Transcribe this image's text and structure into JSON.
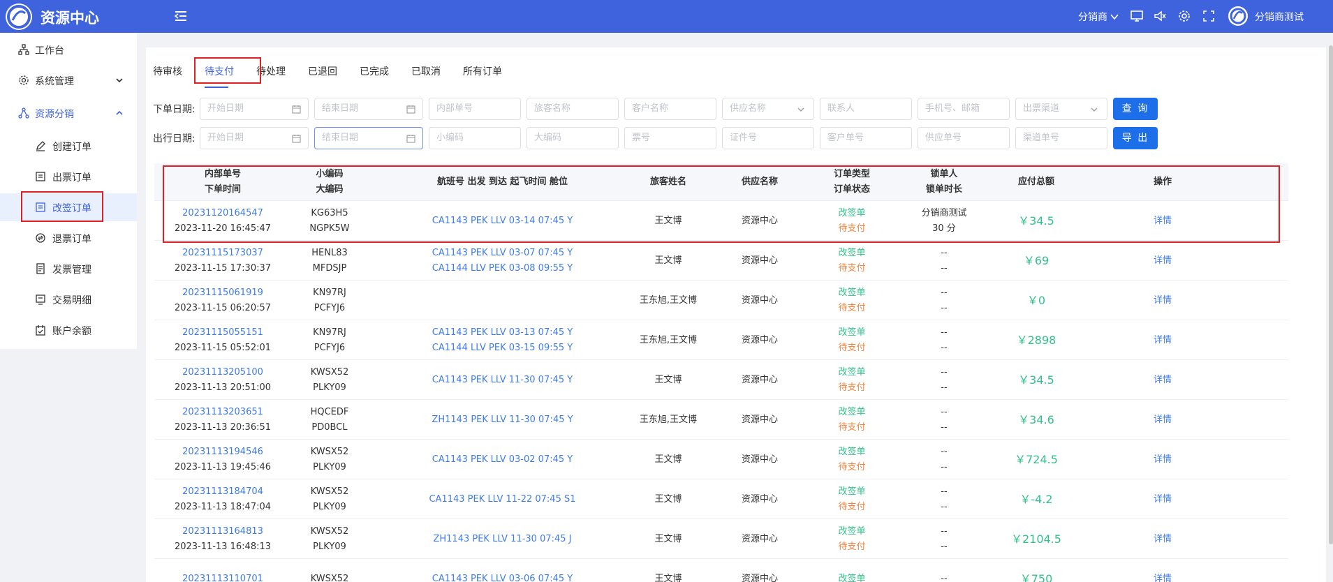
{
  "header": {
    "app_title": "资源中心",
    "role_label": "分销商",
    "user_name": "分销商测试"
  },
  "sidebar": {
    "items": [
      {
        "label": "工作台",
        "icon": "workbench-icon"
      },
      {
        "label": "系统管理",
        "icon": "gear-icon"
      },
      {
        "label": "资源分销",
        "icon": "distribution-icon"
      }
    ],
    "sub_items": [
      {
        "label": "创建订单",
        "icon": "edit-icon"
      },
      {
        "label": "出票订单",
        "icon": "ticket-icon"
      },
      {
        "label": "改签订单",
        "icon": "reschedule-icon"
      },
      {
        "label": "退票订单",
        "icon": "refund-icon"
      },
      {
        "label": "发票管理",
        "icon": "invoice-icon"
      },
      {
        "label": "交易明细",
        "icon": "transaction-icon"
      },
      {
        "label": "账户余额",
        "icon": "balance-icon"
      }
    ]
  },
  "tabs": [
    "待审核",
    "待支付",
    "待处理",
    "已退回",
    "已完成",
    "已取消",
    "所有订单"
  ],
  "filters": {
    "order_date_label": "下单日期:",
    "travel_date_label": "出行日期:",
    "start_date": "开始日期",
    "end_date": "结束日期",
    "row1": [
      "内部单号",
      "旅客名称",
      "客户名称",
      "供应名称",
      "联系人",
      "手机号、邮箱",
      "出票渠道"
    ],
    "row2": [
      "小编码",
      "大编码",
      "票号",
      "证件号",
      "客户单号",
      "供应单号",
      "渠道单号"
    ],
    "query_button": "查 询",
    "export_button": "导 出"
  },
  "table": {
    "headers": {
      "order_no": "内部单号",
      "order_time": "下单时间",
      "small_code": "小编码",
      "big_code": "大编码",
      "flight": "航班号 出发 到达 起飞时间 舱位",
      "passenger": "旅客姓名",
      "supplier": "供应名称",
      "order_type": "订单类型",
      "order_status": "订单状态",
      "locker": "锁单人",
      "lock_duration": "锁单时长",
      "amount": "应付总额",
      "action": "操作"
    },
    "rows": [
      {
        "order_no": "20231120164547",
        "time": "2023-11-20 16:45:47",
        "small": "KG63H5",
        "big": "NGPK5W",
        "flights": [
          "CA1143 PEK LLV 03-14 07:45 Y"
        ],
        "passenger": "王文博",
        "supplier": "资源中心",
        "type": "改签单",
        "status": "待支付",
        "locker": "分销商测试",
        "lock": "30 分",
        "amount": "￥34.5",
        "action": "详情"
      },
      {
        "order_no": "20231115173037",
        "time": "2023-11-15 17:30:37",
        "small": "HENL83",
        "big": "MFDSJP",
        "flights": [
          "CA1143 PEK LLV 03-07 07:45 Y",
          "CA1144 LLV PEK 03-08 09:55 Y"
        ],
        "passenger": "王文博",
        "supplier": "资源中心",
        "type": "改签单",
        "status": "待支付",
        "locker": "--",
        "lock": "--",
        "amount": "￥69",
        "action": "详情"
      },
      {
        "order_no": "20231115061919",
        "time": "2023-11-15 06:20:57",
        "small": "KN97RJ",
        "big": "PCFYJ6",
        "flights": [],
        "passenger": "王东旭,王文博",
        "supplier": "资源中心",
        "type": "改签单",
        "status": "待支付",
        "locker": "--",
        "lock": "--",
        "amount": "￥0",
        "action": "详情"
      },
      {
        "order_no": "20231115055151",
        "time": "2023-11-15 05:52:01",
        "small": "KN97RJ",
        "big": "PCFYJ6",
        "flights": [
          "CA1143 PEK LLV 03-13 07:45 Y",
          "CA1144 LLV PEK 03-15 09:55 Y"
        ],
        "passenger": "王东旭,王文博",
        "supplier": "资源中心",
        "type": "改签单",
        "status": "待支付",
        "locker": "--",
        "lock": "--",
        "amount": "￥2898",
        "action": "详情"
      },
      {
        "order_no": "20231113205100",
        "time": "2023-11-13 20:51:00",
        "small": "KWSX52",
        "big": "PLKY09",
        "flights": [
          "CA1143 PEK LLV 11-30 07:45 Y"
        ],
        "passenger": "王文博",
        "supplier": "资源中心",
        "type": "改签单",
        "status": "待支付",
        "locker": "--",
        "lock": "--",
        "amount": "￥34.5",
        "action": "详情"
      },
      {
        "order_no": "20231113203651",
        "time": "2023-11-13 20:36:51",
        "small": "HQCEDF",
        "big": "PD0BCL",
        "flights": [
          "ZH1143 PEK LLV 11-30 07:45 Y"
        ],
        "passenger": "王东旭,王文博",
        "supplier": "资源中心",
        "type": "改签单",
        "status": "待支付",
        "locker": "--",
        "lock": "--",
        "amount": "￥34.6",
        "action": "详情"
      },
      {
        "order_no": "20231113194546",
        "time": "2023-11-13 19:45:46",
        "small": "KWSX52",
        "big": "PLKY09",
        "flights": [
          "CA1143 PEK LLV 03-02 07:45 Y"
        ],
        "passenger": "王文博",
        "supplier": "资源中心",
        "type": "改签单",
        "status": "待支付",
        "locker": "--",
        "lock": "--",
        "amount": "￥724.5",
        "action": "详情"
      },
      {
        "order_no": "20231113184704",
        "time": "2023-11-13 18:47:04",
        "small": "KWSX52",
        "big": "PLKY09",
        "flights": [
          "CA1143 PEK LLV 11-22 07:45 S1"
        ],
        "passenger": "王文博",
        "supplier": "资源中心",
        "type": "改签单",
        "status": "待支付",
        "locker": "--",
        "lock": "--",
        "amount": "￥-4.2",
        "action": "详情"
      },
      {
        "order_no": "20231113164813",
        "time": "2023-11-13 16:48:13",
        "small": "KWSX52",
        "big": "PLKY09",
        "flights": [
          "ZH1143 PEK LLV 11-30 07:45 J"
        ],
        "passenger": "王文博",
        "supplier": "资源中心",
        "type": "改签单",
        "status": "待支付",
        "locker": "--",
        "lock": "--",
        "amount": "￥2104.5",
        "action": "详情"
      },
      {
        "order_no": "20231113110701",
        "time": "",
        "small": "KWSX52",
        "big": "",
        "flights": [
          "CA1143 PEK LLV 03-06 07:45 Y"
        ],
        "passenger": "王文博",
        "supplier": "资源中心",
        "type": "改签单",
        "status": "",
        "locker": "--",
        "lock": "",
        "amount": "￥750",
        "action": "详情"
      }
    ]
  }
}
